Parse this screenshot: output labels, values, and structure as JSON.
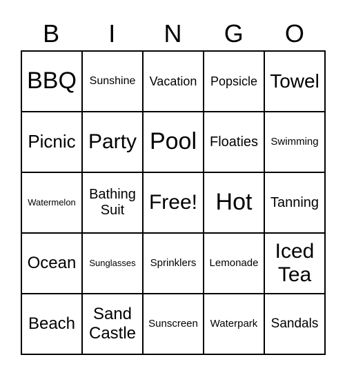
{
  "header": [
    "B",
    "I",
    "N",
    "G",
    "O"
  ],
  "cells": [
    "BBQ",
    "Sunshine",
    "Vacation",
    "Popsicle",
    "Towel",
    "Picnic",
    "Party",
    "Pool",
    "Floaties",
    "Swimming",
    "Watermelon",
    "Bathing Suit",
    "Free!",
    "Hot",
    "Tanning",
    "Ocean",
    "Sunglasses",
    "Sprinklers",
    "Lemonade",
    "Iced Tea",
    "Beach",
    "Sand Castle",
    "Sunscreen",
    "Waterpark",
    "Sandals"
  ]
}
